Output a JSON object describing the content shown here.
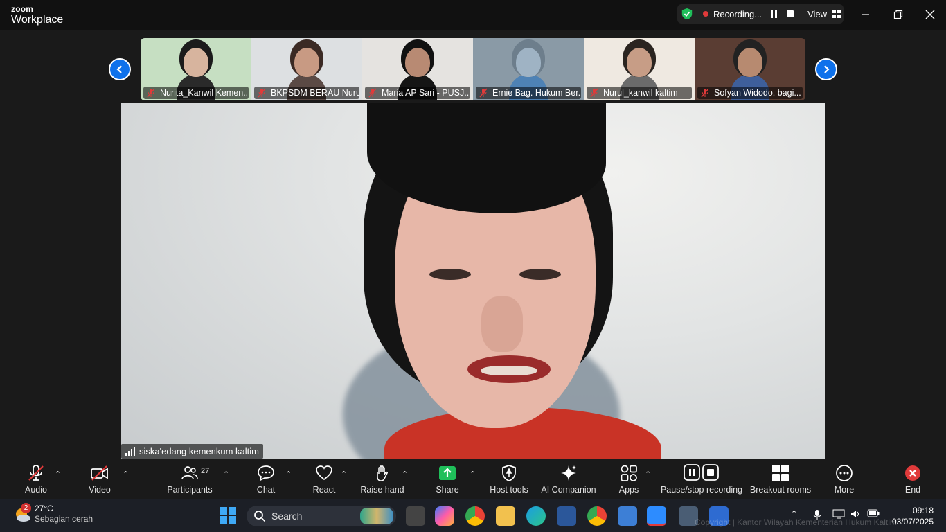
{
  "app": {
    "brand_line1": "zoom",
    "brand_line2": "Workplace"
  },
  "recording": {
    "status_text": "Recording...",
    "view_label": "View"
  },
  "participants_strip": [
    {
      "name": "Nurita_Kanwil Kemen...",
      "bg": "#c6dfc2",
      "hair": "#1b1b1b",
      "skin": "#d7b49e",
      "shirt": "#2a2a2a"
    },
    {
      "name": "BKPSDM BERAU Nuru...",
      "bg": "#dde0e2",
      "hair": "#3b2a24",
      "skin": "#c89a83",
      "shirt": "#5b4a45"
    },
    {
      "name": "Maria AP Sari - PUSJ...",
      "bg": "#e5e3e0",
      "hair": "#111111",
      "skin": "#b88a73",
      "shirt": "#151515"
    },
    {
      "name": "Ernie Bag. Hukum Ber...",
      "bg": "#8a9aa6",
      "hair": "#6d7e8c",
      "skin": "#9fb3c4",
      "shirt": "#4e82b5"
    },
    {
      "name": "Nurul_kanwil kaltim",
      "bg": "#efe9e1",
      "hair": "#2a2420",
      "skin": "#c79d86",
      "shirt": "#6b6b6b"
    },
    {
      "name": "Sofyan Widodo. bagi...",
      "bg": "#5a3d33",
      "hair": "#222222",
      "skin": "#b78a70",
      "shirt": "#3e5f9b"
    }
  ],
  "main_speaker": {
    "name": "siska'edang kemenkum kaltim"
  },
  "toolbar": {
    "audio": "Audio",
    "video": "Video",
    "participants": "Participants",
    "participants_count": "27",
    "chat": "Chat",
    "react": "React",
    "raise_hand": "Raise hand",
    "share": "Share",
    "host_tools": "Host tools",
    "ai_companion": "AI Companion",
    "apps": "Apps",
    "pause_stop": "Pause/stop recording",
    "breakout": "Breakout rooms",
    "more": "More",
    "end": "End"
  },
  "taskbar": {
    "weather_badge": "2",
    "temperature": "27°C",
    "weather_desc": "Sebagian cerah",
    "search_placeholder": "Search",
    "time": "09:18",
    "date": "03/07/2025",
    "watermark": "Copyright | Kantor Wilayah Kementerian Hukum Kaltim"
  },
  "colors": {
    "accent_blue": "#0e71eb",
    "share_green": "#1fbf5a",
    "end_red": "#e03a3a"
  }
}
